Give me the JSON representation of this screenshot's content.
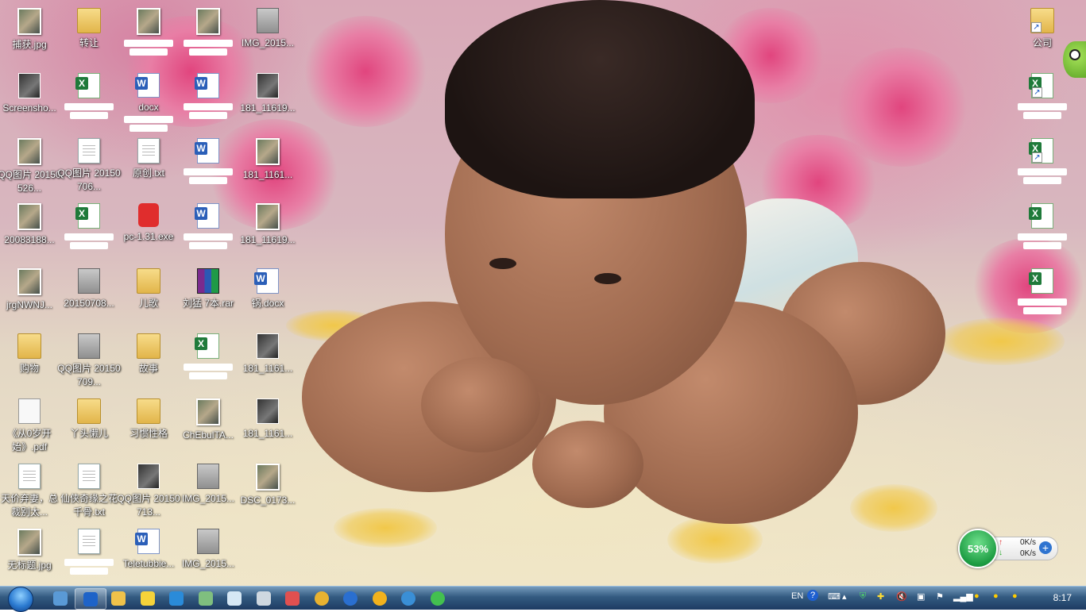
{
  "desktop": {
    "icons_left": [
      {
        "label": "捕获.jpg",
        "type": "photo"
      },
      {
        "label": "Screensho...",
        "type": "dark"
      },
      {
        "label": "QQ图片 20150526...",
        "type": "photo"
      },
      {
        "label": "20083188...",
        "type": "photo"
      },
      {
        "label": "jrgNWNJ...",
        "type": "photo"
      },
      {
        "label": "购物",
        "type": "folder"
      },
      {
        "label": "《从0岁开始》.pdf",
        "type": "pdf"
      },
      {
        "label": "天价弃妻，总裁别太...",
        "type": "doc"
      },
      {
        "label": "无标题.jpg",
        "type": "photo"
      },
      {
        "label": "转让",
        "type": "folder"
      },
      {
        "label": "",
        "type": "excel",
        "redacted": true
      },
      {
        "label": "QQ图片 20150706...",
        "type": "doc"
      },
      {
        "label": "",
        "type": "excel",
        "redacted": true
      },
      {
        "label": "20150708...",
        "type": "gray-file"
      },
      {
        "label": "QQ图片 20150709...",
        "type": "gray-file"
      },
      {
        "label": "丫头懒儿",
        "type": "folder"
      },
      {
        "label": "仙侠奇缘之花千骨.txt",
        "type": "doc"
      },
      {
        "label": "",
        "type": "doc",
        "redacted": true
      },
      {
        "label": "",
        "type": "photo",
        "redacted": true
      },
      {
        "label": "docx",
        "type": "word",
        "redacted": true
      },
      {
        "label": "原创.txt",
        "type": "doc"
      },
      {
        "label": "pc-1.31.exe",
        "type": "exe"
      },
      {
        "label": "儿歌",
        "type": "folder"
      },
      {
        "label": "故事",
        "type": "folder"
      },
      {
        "label": "习惯性格",
        "type": "folder"
      },
      {
        "label": "QQ图片 20150713...",
        "type": "dark"
      },
      {
        "label": "Teletubbie...",
        "type": "word"
      },
      {
        "label": "",
        "type": "photo",
        "redacted": true
      },
      {
        "label": "",
        "type": "word",
        "redacted": true
      },
      {
        "label": "",
        "type": "word",
        "redacted": true
      },
      {
        "label": "",
        "type": "word",
        "redacted": true
      },
      {
        "label": "刘猛 7本.rar",
        "type": "rar"
      },
      {
        "label": "",
        "type": "excel",
        "redacted": true
      },
      {
        "label": "ChEbulTA...",
        "type": "photo"
      },
      {
        "label": "IMG_2015...",
        "type": "gray-file"
      },
      {
        "label": "IMG_2015...",
        "type": "gray-file"
      },
      {
        "label": "IMG_2015...",
        "type": "gray-file"
      },
      {
        "label": "181_11619...",
        "type": "dark"
      },
      {
        "label": "181_1161...",
        "type": "photo"
      },
      {
        "label": "181_11619...",
        "type": "photo"
      },
      {
        "label": "锅.docx",
        "type": "word"
      },
      {
        "label": "181_1161...",
        "type": "dark"
      },
      {
        "label": "181_1161...",
        "type": "dark"
      },
      {
        "label": "DSC_0173...",
        "type": "photo"
      }
    ],
    "icons_right": [
      {
        "label": "公司",
        "type": "folder",
        "shortcut": true
      },
      {
        "label": "",
        "type": "excel",
        "shortcut": true,
        "redacted": true
      },
      {
        "label": "",
        "type": "excel",
        "shortcut": true,
        "redacted": true
      },
      {
        "label": "",
        "type": "excel",
        "redacted": true
      },
      {
        "label": "",
        "type": "excel",
        "redacted": true
      }
    ]
  },
  "net_widget": {
    "percent": "53%",
    "upload": "0K/s",
    "download": "0K/s"
  },
  "taskbar": {
    "apps": [
      "app-1",
      "app-2-active",
      "explorer",
      "qq",
      "ie",
      "remote",
      "notepad",
      "calculator",
      "paint",
      "chrome",
      "k-browser",
      "app-yellow",
      "app-network",
      "app-green"
    ],
    "tray": {
      "language": "EN",
      "clock": "8:17"
    }
  },
  "colors": {
    "taskbar": "#2d557d",
    "accent": "#1d9c43"
  }
}
